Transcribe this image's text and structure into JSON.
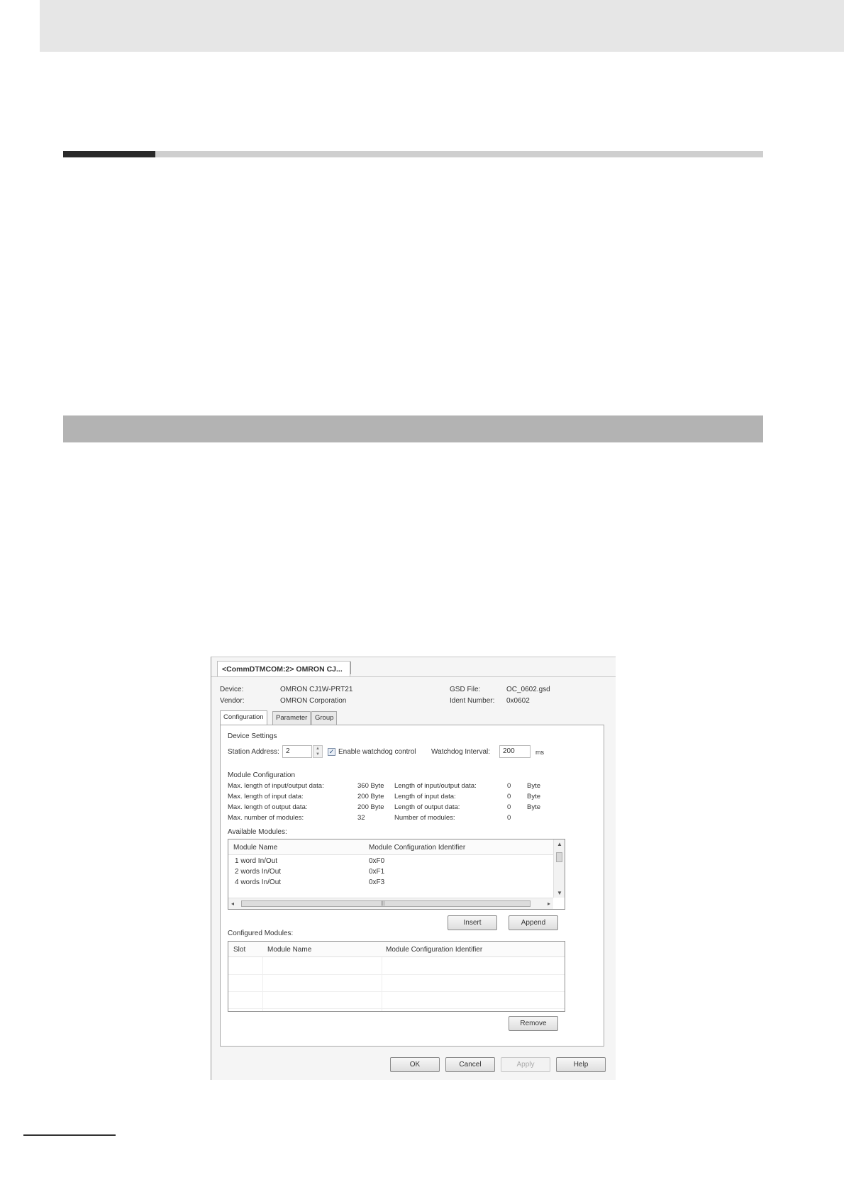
{
  "dialog": {
    "tab_title": "<CommDTMCOM:2> OMRON CJ...",
    "device_label": "Device:",
    "device_value": "OMRON CJ1W-PRT21",
    "vendor_label": "Vendor:",
    "vendor_value": "OMRON Corporation",
    "gsd_label": "GSD File:",
    "gsd_value": "OC_0602.gsd",
    "ident_label": "Ident Number:",
    "ident_value": "0x0602",
    "tabs": [
      "Configuration",
      "Parameter",
      "Group"
    ],
    "active_tab": "Configuration",
    "device_settings": {
      "heading": "Device Settings",
      "station_label": "Station Address:",
      "station_value": "2",
      "watchdog_checkbox_label": "Enable watchdog control",
      "watchdog_checked": true,
      "watchdog_interval_label": "Watchdog Interval:",
      "watchdog_interval_value": "200",
      "watchdog_unit": "ms"
    },
    "module_config": {
      "heading": "Module Configuration",
      "rows": [
        {
          "label": "Max. length of input/output data:",
          "value": "360 Byte",
          "label2": "Length of input/output data:",
          "value2": "0",
          "unit2": "Byte"
        },
        {
          "label": "Max. length of input data:",
          "value": "200 Byte",
          "label2": "Length of input data:",
          "value2": "0",
          "unit2": "Byte"
        },
        {
          "label": "Max. length of output data:",
          "value": "200 Byte",
          "label2": "Length of output data:",
          "value2": "0",
          "unit2": "Byte"
        },
        {
          "label": "Max. number of modules:",
          "value": "32",
          "label2": "Number of modules:",
          "value2": "0",
          "unit2": ""
        }
      ]
    },
    "available_modules": {
      "heading": "Available Modules:",
      "columns": [
        "Module Name",
        "Module Configuration Identifier"
      ],
      "rows": [
        {
          "name": "1 word  In/Out",
          "id": "0xF0"
        },
        {
          "name": "2 words In/Out",
          "id": "0xF1"
        },
        {
          "name": "4 words In/Out",
          "id": "0xF3"
        }
      ]
    },
    "insert_label": "Insert",
    "append_label": "Append",
    "configured_modules": {
      "heading": "Configured Modules:",
      "columns": [
        "Slot",
        "Module Name",
        "Module Configuration Identifier"
      ]
    },
    "remove_label": "Remove",
    "footer_buttons": {
      "ok": "OK",
      "cancel": "Cancel",
      "apply": "Apply",
      "help": "Help"
    }
  }
}
